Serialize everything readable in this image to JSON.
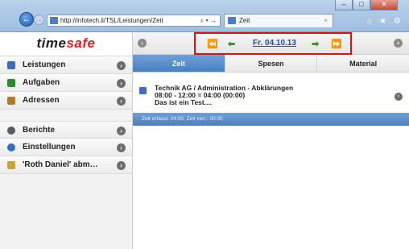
{
  "browser": {
    "address": "http://infotech.li/TSL/Leistungen/Zeit",
    "address_tools": "⌕ ▾ →",
    "tab_title": "Zeit",
    "tab_close": "×",
    "window_buttons": {
      "minimize": "–",
      "maximize": "□",
      "close": "✕"
    },
    "icons": [
      "home-icon",
      "star-icon",
      "gear-icon"
    ],
    "icon_glyphs": {
      "home": "⌂",
      "star": "★",
      "gear": "⚙"
    },
    "back_glyph": "←",
    "forward_glyph": "→"
  },
  "app": {
    "logo_prefix": "time",
    "logo_suffix": "safe",
    "sidebar": {
      "items": [
        {
          "label": "Leistungen",
          "icon": "clock-icon"
        },
        {
          "label": "Aufgaben",
          "icon": "tasks-icon"
        },
        {
          "label": "Adressen",
          "icon": "contacts-icon"
        },
        {
          "label": "Berichte",
          "icon": "reports-icon"
        },
        {
          "label": "Einstellungen",
          "icon": "settings-icon"
        },
        {
          "label": "'Roth Daniel' abm…",
          "icon": "user-icon"
        }
      ],
      "chevron": "›"
    },
    "toolbar": {
      "left_glyph": "‹",
      "right_glyph": "+",
      "prev_fast": "⏪",
      "prev": "⬅",
      "date": "Fr. 04.10.13",
      "next": "➡",
      "next_fast": "⏩"
    },
    "tabs": [
      {
        "label": "Zeit",
        "active": true
      },
      {
        "label": "Spesen",
        "active": false
      },
      {
        "label": "Material",
        "active": false
      }
    ],
    "entry": {
      "line1": "Technik AG / Administration - Abklärungen",
      "line2": "08:00 - 12:00 = 04:00 (00:00)",
      "line3": "Das ist ein Test....",
      "chevron": "›"
    },
    "summary": "Zeit erfasst: 04:00, Zeit verr.: 00:00"
  },
  "colors": {
    "accent_blue": "#4a7fc0",
    "logo_red": "#e01e1e",
    "highlight_red": "#e01010",
    "arrow_green": "#2e9a1a"
  }
}
